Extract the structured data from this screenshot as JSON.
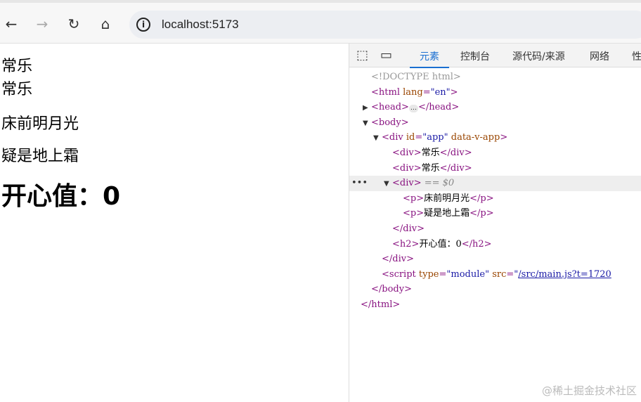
{
  "browser": {
    "url": "localhost:5173",
    "icons": {
      "back": "back-arrow-icon",
      "forward": "forward-arrow-icon",
      "reload": "reload-icon",
      "home": "home-icon",
      "info": "info-icon"
    }
  },
  "page": {
    "divs": [
      "常乐",
      "常乐"
    ],
    "paragraphs": [
      "床前明月光",
      "疑是地上霜"
    ],
    "heading": "开心值：0"
  },
  "devtools": {
    "tabs": [
      "元素",
      "控制台",
      "源代码/来源",
      "网络",
      "性"
    ],
    "active_tab": 0,
    "lines": [
      {
        "indent": 0,
        "toks": [
          [
            "dt",
            "<!DOCTYPE html>"
          ]
        ]
      },
      {
        "indent": 0,
        "toks": [
          [
            "tag",
            "<html "
          ],
          [
            "an",
            "lang"
          ],
          [
            "tag",
            "="
          ],
          [
            "av",
            "\"en\""
          ],
          [
            "tag",
            ">"
          ]
        ]
      },
      {
        "indent": 0,
        "tri": "▶",
        "toks": [
          [
            "tag",
            "<head>"
          ],
          [
            "ell",
            "…"
          ],
          [
            "tag",
            "</head>"
          ]
        ]
      },
      {
        "indent": 0,
        "tri": "▼",
        "toks": [
          [
            "tag",
            "<body>"
          ]
        ]
      },
      {
        "indent": 1,
        "tri": "▼",
        "toks": [
          [
            "tag",
            "<div "
          ],
          [
            "an",
            "id"
          ],
          [
            "tag",
            "="
          ],
          [
            "av",
            "\"app\""
          ],
          [
            "an",
            " data-v-app"
          ],
          [
            "tag",
            ">"
          ]
        ]
      },
      {
        "indent": 2,
        "toks": [
          [
            "tag",
            "<div>"
          ],
          [
            "tx",
            "常乐"
          ],
          [
            "tag",
            "</div>"
          ]
        ]
      },
      {
        "indent": 2,
        "toks": [
          [
            "tag",
            "<div>"
          ],
          [
            "tx",
            "常乐"
          ],
          [
            "tag",
            "</div>"
          ]
        ]
      },
      {
        "indent": 2,
        "tri": "▼",
        "sel": true,
        "toks": [
          [
            "tag",
            "<div>"
          ],
          [
            "eq",
            " == $0"
          ]
        ]
      },
      {
        "indent": 3,
        "toks": [
          [
            "tag",
            "<p>"
          ],
          [
            "tx",
            "床前明月光"
          ],
          [
            "tag",
            "</p>"
          ]
        ]
      },
      {
        "indent": 3,
        "toks": [
          [
            "tag",
            "<p>"
          ],
          [
            "tx",
            "疑是地上霜"
          ],
          [
            "tag",
            "</p>"
          ]
        ]
      },
      {
        "indent": 2,
        "toks": [
          [
            "tag",
            "</div>"
          ]
        ]
      },
      {
        "indent": 2,
        "toks": [
          [
            "tag",
            "<h2>"
          ],
          [
            "tx",
            "开心值：0"
          ],
          [
            "tag",
            "</h2>"
          ]
        ]
      },
      {
        "indent": 1,
        "toks": [
          [
            "tag",
            "</div>"
          ]
        ]
      },
      {
        "indent": 1,
        "toks": [
          [
            "tag",
            "<script "
          ],
          [
            "an",
            "type"
          ],
          [
            "tag",
            "="
          ],
          [
            "av",
            "\"module\""
          ],
          [
            "an",
            " src"
          ],
          [
            "tag",
            "="
          ],
          [
            "av",
            "\""
          ],
          [
            "lk",
            "/src/main.js?t=1720"
          ]
        ]
      },
      {
        "indent": 0,
        "toks": [
          [
            "tag",
            "</body>"
          ]
        ]
      },
      {
        "indent": -1,
        "toks": [
          [
            "tag",
            "</html>"
          ]
        ]
      }
    ]
  },
  "watermark": "@稀土掘金技术社区"
}
